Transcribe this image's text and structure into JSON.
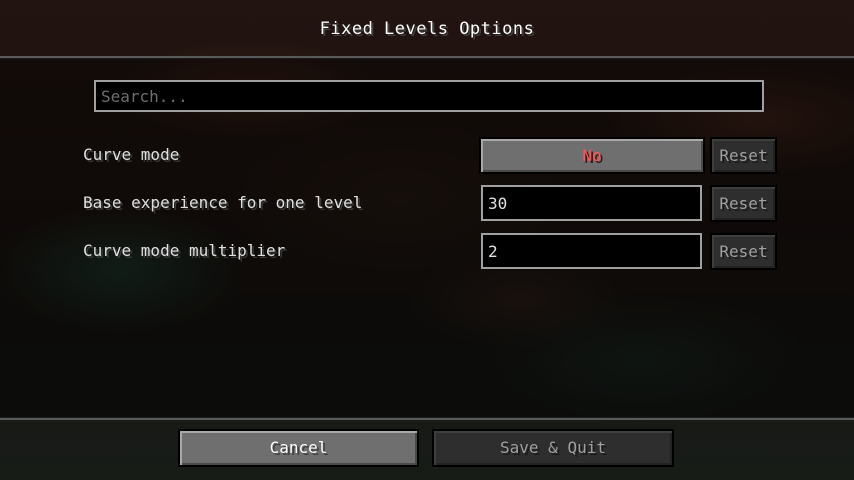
{
  "screen": {
    "title": "Fixed Levels Options"
  },
  "search": {
    "placeholder": "Search...",
    "value": ""
  },
  "options": [
    {
      "label": "Curve mode",
      "type": "toggle",
      "value": "No",
      "reset_label": "Reset",
      "value_color": "#ff5555"
    },
    {
      "label": "Base experience for one level",
      "type": "number",
      "value": "30",
      "reset_label": "Reset"
    },
    {
      "label": "Curve mode multiplier",
      "type": "number",
      "value": "2",
      "reset_label": "Reset"
    }
  ],
  "footer": {
    "cancel_label": "Cancel",
    "save_label": "Save & Quit"
  }
}
